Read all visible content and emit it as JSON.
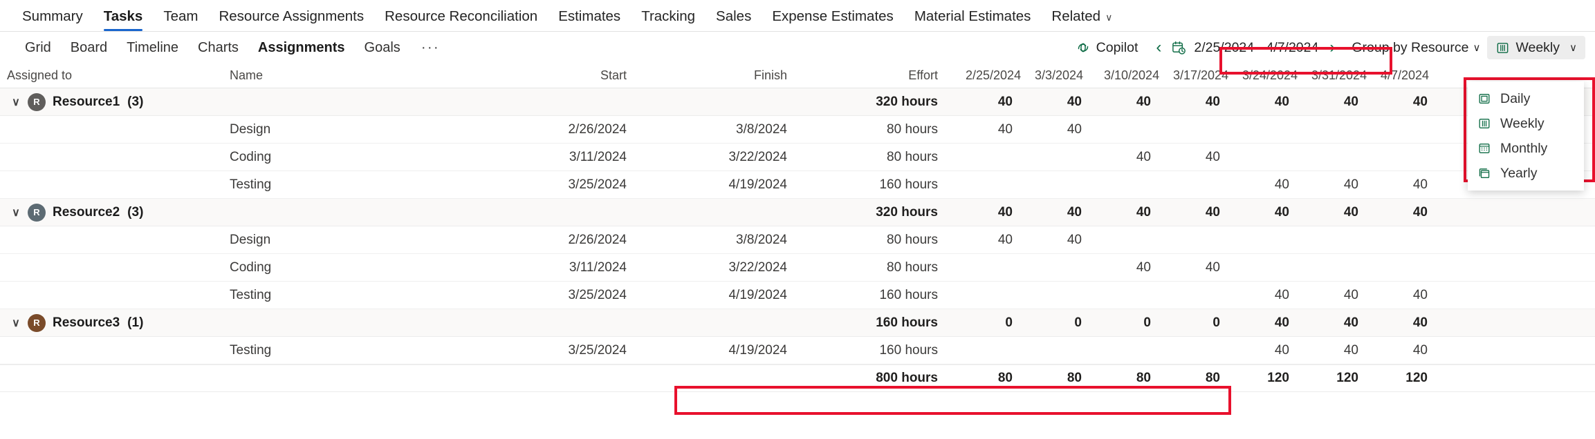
{
  "top_tabs": [
    {
      "label": "Summary",
      "active": false,
      "caret": false
    },
    {
      "label": "Tasks",
      "active": true,
      "caret": false
    },
    {
      "label": "Team",
      "active": false,
      "caret": false
    },
    {
      "label": "Resource Assignments",
      "active": false,
      "caret": false
    },
    {
      "label": "Resource Reconciliation",
      "active": false,
      "caret": false
    },
    {
      "label": "Estimates",
      "active": false,
      "caret": false
    },
    {
      "label": "Tracking",
      "active": false,
      "caret": false
    },
    {
      "label": "Sales",
      "active": false,
      "caret": false
    },
    {
      "label": "Expense Estimates",
      "active": false,
      "caret": false
    },
    {
      "label": "Material Estimates",
      "active": false,
      "caret": false
    },
    {
      "label": "Related",
      "active": false,
      "caret": true
    }
  ],
  "sub_tabs": [
    {
      "label": "Grid",
      "active": false
    },
    {
      "label": "Board",
      "active": false
    },
    {
      "label": "Timeline",
      "active": false
    },
    {
      "label": "Charts",
      "active": false
    },
    {
      "label": "Assignments",
      "active": true
    },
    {
      "label": "Goals",
      "active": false
    }
  ],
  "sub_tabs_overflow": "···",
  "commandbar": {
    "copilot_label": "Copilot",
    "prev_glyph": "‹",
    "next_glyph": "›",
    "date_range": "2/25/2024 - 4/7/2024",
    "group_by_label": "Group by Resource",
    "group_by_caret": "∨",
    "scale_label": "Weekly",
    "scale_caret": "∨"
  },
  "scale_menu": {
    "items": [
      {
        "label": "Daily",
        "icon": "daily-scale-icon"
      },
      {
        "label": "Weekly",
        "icon": "weekly-scale-icon"
      },
      {
        "label": "Monthly",
        "icon": "monthly-scale-icon"
      },
      {
        "label": "Yearly",
        "icon": "yearly-scale-icon"
      }
    ]
  },
  "grid": {
    "columns": [
      "Assigned to",
      "Name",
      "Start",
      "Finish",
      "Effort"
    ],
    "period_columns": [
      "2/25/2024",
      "3/3/2024",
      "3/10/2024",
      "3/17/2024",
      "3/24/2024",
      "3/31/2024",
      "4/7/2024"
    ],
    "groups": [
      {
        "name": "Resource1",
        "count": "(3)",
        "initial": "R",
        "avatar_color": "#605e5c",
        "expander": "∨",
        "effort": "320 hours",
        "periods": [
          "40",
          "40",
          "40",
          "40",
          "40",
          "40",
          "40"
        ],
        "tasks": [
          {
            "name": "Design",
            "start": "2/26/2024",
            "finish": "3/8/2024",
            "effort": "80 hours",
            "periods": [
              "40",
              "40",
              "",
              "",
              "",
              "",
              ""
            ]
          },
          {
            "name": "Coding",
            "start": "3/11/2024",
            "finish": "3/22/2024",
            "effort": "80 hours",
            "periods": [
              "",
              "",
              "40",
              "40",
              "",
              "",
              ""
            ]
          },
          {
            "name": "Testing",
            "start": "3/25/2024",
            "finish": "4/19/2024",
            "effort": "160 hours",
            "periods": [
              "",
              "",
              "",
              "",
              "40",
              "40",
              "40"
            ]
          }
        ]
      },
      {
        "name": "Resource2",
        "count": "(3)",
        "initial": "R",
        "avatar_color": "#5d6b73",
        "expander": "∨",
        "effort": "320 hours",
        "periods": [
          "40",
          "40",
          "40",
          "40",
          "40",
          "40",
          "40"
        ],
        "tasks": [
          {
            "name": "Design",
            "start": "2/26/2024",
            "finish": "3/8/2024",
            "effort": "80 hours",
            "periods": [
              "40",
              "40",
              "",
              "",
              "",
              "",
              ""
            ]
          },
          {
            "name": "Coding",
            "start": "3/11/2024",
            "finish": "3/22/2024",
            "effort": "80 hours",
            "periods": [
              "",
              "",
              "40",
              "40",
              "",
              "",
              ""
            ]
          },
          {
            "name": "Testing",
            "start": "3/25/2024",
            "finish": "4/19/2024",
            "effort": "160 hours",
            "periods": [
              "",
              "",
              "",
              "",
              "40",
              "40",
              "40"
            ]
          }
        ]
      },
      {
        "name": "Resource3",
        "count": "(1)",
        "initial": "R",
        "avatar_color": "#7a4b2a",
        "expander": "∨",
        "effort": "160 hours",
        "periods": [
          "0",
          "0",
          "0",
          "0",
          "40",
          "40",
          "40"
        ],
        "tasks": [
          {
            "name": "Testing",
            "start": "3/25/2024",
            "finish": "4/19/2024",
            "effort": "160 hours",
            "periods": [
              "",
              "",
              "",
              "",
              "40",
              "40",
              "40"
            ]
          }
        ]
      }
    ],
    "total": {
      "effort": "800 hours",
      "periods": [
        "80",
        "80",
        "80",
        "80",
        "120",
        "120",
        "120"
      ]
    }
  },
  "colors": {
    "accent_tab_underline": "#1966cd",
    "brand_green": "#0f6c46",
    "annotation_red": "#e8112d",
    "group_row_bg": "#faf9f8"
  }
}
